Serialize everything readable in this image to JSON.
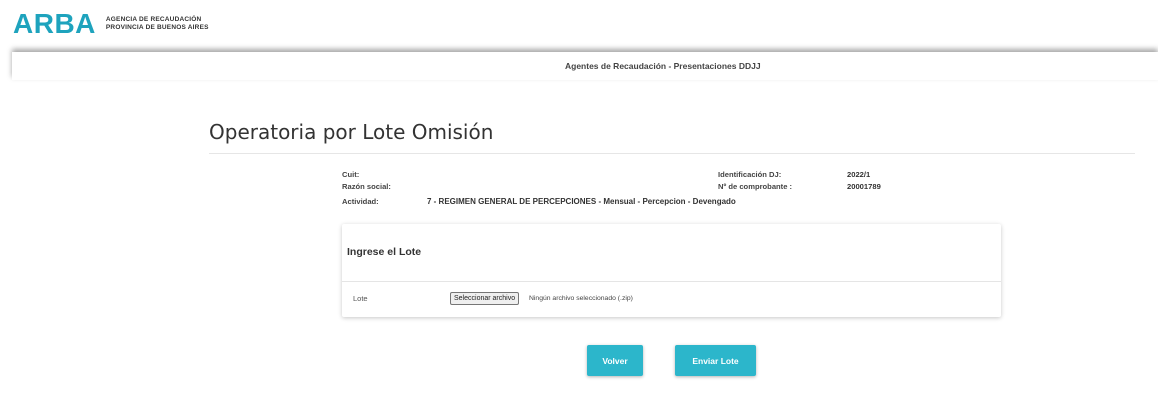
{
  "header": {
    "logo_mark": "ARBA",
    "logo_line1": "AGENCIA DE RECAUDACIÓN",
    "logo_line2": "PROVINCIA DE BUENOS AIRES",
    "section_title": "Agentes de Recaudación - Presentaciones DDJJ"
  },
  "page": {
    "title": "Operatoria por Lote Omisión"
  },
  "info": {
    "cuit_label": "Cuit:",
    "razon_label": "Razón social:",
    "actividad_label": "Actividad:",
    "actividad_value": "7 - REGIMEN GENERAL DE PERCEPCIONES - Mensual - Percepcion - Devengado",
    "identificacion_label": "Identificación DJ:",
    "identificacion_value": "2022/1",
    "comprobante_label": "Nº de comprobante :",
    "comprobante_value": "20001789"
  },
  "panel": {
    "title": "Ingrese el Lote",
    "lote_label": "Lote",
    "file_button": "Seleccionar archivo",
    "file_status": "Ningún archivo seleccionado (.zip)"
  },
  "actions": {
    "back_label": "Volver",
    "send_label": "Enviar Lote"
  },
  "colors": {
    "brand": "#1ea3bd",
    "button": "#2cb6cb"
  }
}
